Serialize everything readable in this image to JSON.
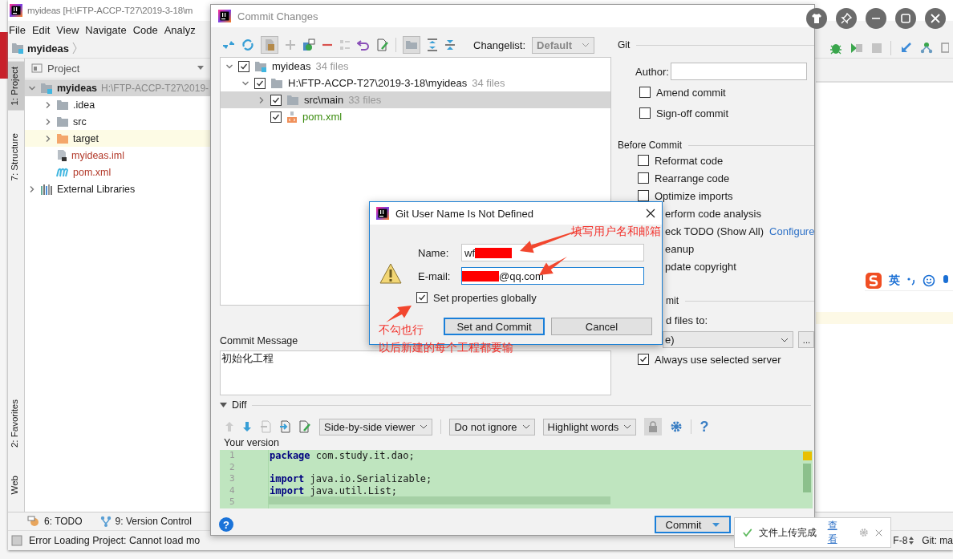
{
  "ide": {
    "title": "myideas [H:\\FTP-ACCP-T27\\2019-3-18\\m",
    "menu": [
      "File",
      "Edit",
      "View",
      "Navigate",
      "Code",
      "Analyz"
    ],
    "breadcrumb": "myideas",
    "side_tabs_top": [
      {
        "label": "1: Project",
        "selected": true
      },
      {
        "label": "7: Structure",
        "selected": false
      }
    ],
    "side_tabs_bottom": [
      {
        "label": "2: Favorites",
        "selected": false
      },
      {
        "label": "Web",
        "selected": false
      }
    ],
    "project_panel": {
      "title": "Project",
      "tree": [
        {
          "name": "myideas",
          "detail": "H:\\FTP-ACCP-T27\\2019-",
          "kind": "module",
          "expanded": true,
          "selected": true,
          "untracked": false,
          "children": [
            {
              "name": ".idea",
              "kind": "folder",
              "expanded": false,
              "selected": false,
              "untracked": false
            },
            {
              "name": "src",
              "kind": "folder",
              "expanded": false,
              "selected": false,
              "untracked": false
            },
            {
              "name": "target",
              "kind": "excluded",
              "expanded": false,
              "selected": false,
              "untracked": false
            },
            {
              "name": "myideas.iml",
              "kind": "iml",
              "selected": false,
              "untracked": true
            },
            {
              "name": "pom.xml",
              "kind": "maven",
              "selected": false,
              "untracked": true
            }
          ]
        },
        {
          "name": "External Libraries",
          "kind": "library",
          "expanded": false,
          "selected": false,
          "untracked": false
        }
      ]
    },
    "ime_bar": {
      "label": "英"
    },
    "bottom_tabs": [
      {
        "label": "6: TODO",
        "kind": "todo"
      },
      {
        "label": "9: Version Control",
        "kind": "vcs"
      }
    ],
    "status": {
      "message": "Error Loading Project: Cannot load mo",
      "encoding": "F-8",
      "branch": "Git: ma"
    }
  },
  "commit": {
    "title": "Commit Changes",
    "changelist_label": "Changelist:",
    "changelist": "Default",
    "tree": [
      {
        "name": "myideas",
        "count": "34 files",
        "kind": "module",
        "checked": true,
        "expanded": true,
        "selected": false,
        "added": false,
        "children": [
          {
            "name": "H:\\FTP-ACCP-T27\\2019-3-18\\myideas",
            "count": "34 files",
            "kind": "folder",
            "checked": true,
            "expanded": true,
            "selected": false,
            "added": false,
            "children": [
              {
                "name": "src\\main",
                "count": "33 files",
                "kind": "folder",
                "checked": true,
                "expanded": false,
                "selected": true,
                "added": false
              },
              {
                "name": "pom.xml",
                "kind": "xml",
                "checked": true,
                "selected": false,
                "added": true
              }
            ]
          }
        ]
      }
    ],
    "commit_message_label": "Commit Message",
    "commit_message": "初始化工程",
    "git": {
      "title": "Git",
      "author_label": "Author:",
      "options": [
        {
          "label": "Amend commit",
          "checked": false
        },
        {
          "label": "Sign-off commit",
          "checked": false
        }
      ]
    },
    "before_commit": {
      "title": "Before Commit",
      "items": [
        {
          "label": "Reformat code",
          "kind": "checkbox",
          "checked": false
        },
        {
          "label": "Rearrange code",
          "kind": "checkbox",
          "checked": false
        },
        {
          "label": "Optimize imports",
          "kind": "checkbox",
          "checked": false
        },
        {
          "label": "erform code analysis",
          "kind": "partial"
        },
        {
          "label": "eck TODO (Show All)",
          "kind": "partial",
          "link": "Configure"
        },
        {
          "label": "eanup",
          "kind": "partial"
        },
        {
          "label": "pdate copyright",
          "kind": "partial"
        }
      ]
    },
    "after_commit": {
      "title": "mit",
      "label": "d files to:",
      "dropdown": "e)",
      "more": "...",
      "option": {
        "label": "Always use selected server",
        "checked": true
      }
    },
    "diff": {
      "title": "Diff",
      "expanded": true,
      "viewer": "Side-by-side viewer",
      "ignore": "Do not ignore",
      "highlight": "Highlight words",
      "help": "?",
      "version_label": "Your version",
      "lines": [
        {
          "number": "1",
          "code": "**package** com.study.it.dao;"
        },
        {
          "number": "2"
        },
        {
          "number": "3",
          "code": "**import** java.io.Serializable;"
        },
        {
          "number": "4",
          "code": "**import** java.util.List;"
        },
        {
          "number": "5"
        }
      ]
    },
    "help_button": "?",
    "commit_button": "Commit"
  },
  "git_dialog": {
    "title": "Git User Name Is Not Defined",
    "name_label": "Name:",
    "name_value": "wf",
    "email_label": "E-mail:",
    "email_value": "@qq.com",
    "email_focused": true,
    "global": {
      "label": "Set properties globally",
      "checked": true
    },
    "buttons": [
      {
        "label": "Set and Commit",
        "default": true
      },
      {
        "label": "Cancel",
        "default": false
      }
    ]
  },
  "annotations": [
    {
      "text": "填写用户名和邮箱"
    },
    {
      "text": "不勾也行"
    },
    {
      "text": "以后新建的每个工程都要输"
    }
  ],
  "notification": {
    "message": "文件上传完成",
    "link": "查看"
  }
}
